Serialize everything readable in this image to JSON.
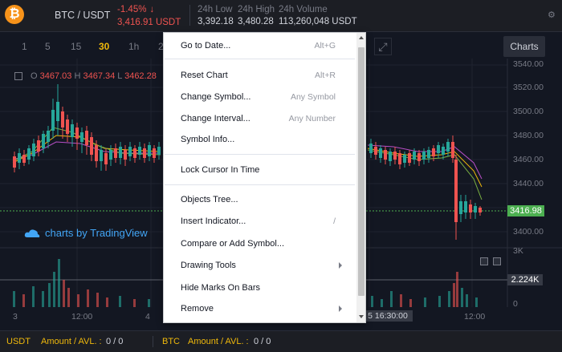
{
  "ticker": {
    "pair": "BTC / USDT",
    "change": "-1.45%",
    "last_price": "3,416.91 USDT",
    "low_label": "24h Low",
    "low_value": "3,392.18",
    "high_label": "24h High",
    "high_value": "3,480.28",
    "volume_label": "24h Volume",
    "volume_value": "113,260,048 USDT",
    "logo_glyph": "₿"
  },
  "toolbar": {
    "intervals": [
      "1",
      "5",
      "15",
      "30",
      "1h",
      "2"
    ],
    "active_interval": "30",
    "charts_button": "Charts"
  },
  "chart": {
    "ohlc": {
      "o_label": "O",
      "o": "3467.03",
      "h_label": "H",
      "h": "3467.34",
      "l_label": "L",
      "l": "3462.28"
    },
    "watermark": "charts by TradingView",
    "price_axis": [
      "3540.00",
      "3520.00",
      "3500.00",
      "3480.00",
      "3460.00",
      "3440.00",
      "3420.00",
      "3400.00",
      "3K",
      "0"
    ],
    "current_price": "3416.98",
    "volume_value": "2.224K",
    "time_axis": [
      "3",
      "12:00",
      "4",
      "12:00"
    ],
    "crosshair_time": "5 16:30:00",
    "colors": {
      "up": "#26a69a",
      "down": "#ef5350",
      "accent": "#f0b90b",
      "price_tag": "#4caf50"
    }
  },
  "menu": {
    "items": [
      {
        "label": "Go to Date...",
        "shortcut": "Alt+G"
      },
      {
        "label": "Reset Chart",
        "shortcut": "Alt+R"
      },
      {
        "label": "Change Symbol...",
        "shortcut": "Any Symbol"
      },
      {
        "label": "Change Interval...",
        "shortcut": "Any Number"
      },
      {
        "label": "Symbol Info...",
        "shortcut": ""
      },
      {
        "label": "Lock Cursor In Time",
        "shortcut": ""
      },
      {
        "label": "Objects Tree...",
        "shortcut": ""
      },
      {
        "label": "Insert Indicator...",
        "shortcut": "/"
      },
      {
        "label": "Compare or Add Symbol...",
        "shortcut": ""
      },
      {
        "label": "Drawing Tools",
        "shortcut": ""
      },
      {
        "label": "Hide Marks On Bars",
        "shortcut": ""
      },
      {
        "label": "Remove",
        "shortcut": ""
      }
    ]
  },
  "footer": {
    "left_asset": "USDT",
    "left_label": "Amount / AVL. :",
    "left_value": "0 / 0",
    "right_asset": "BTC",
    "right_label": "Amount / AVL. :",
    "right_value": "0 / 0"
  }
}
